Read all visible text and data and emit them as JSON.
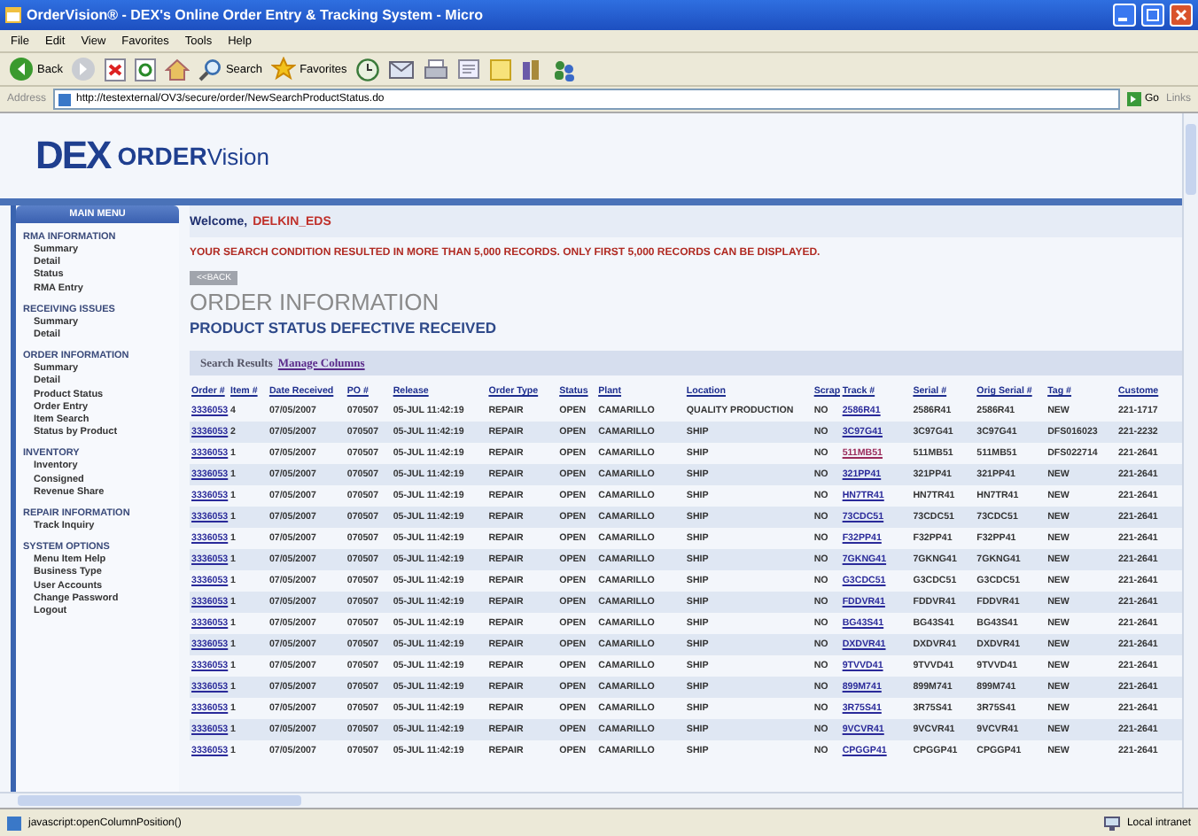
{
  "window": {
    "title": "OrderVision® - DEX's Online Order Entry & Tracking System - Micro"
  },
  "menu": [
    "File",
    "Edit",
    "View",
    "Favorites",
    "Tools",
    "Help"
  ],
  "toolbar": [
    {
      "kind": "back",
      "label": "Back"
    },
    {
      "kind": "forward"
    },
    {
      "kind": "stop"
    },
    {
      "kind": "refresh"
    },
    {
      "kind": "home"
    },
    {
      "kind": "search",
      "label": "Search"
    },
    {
      "kind": "favorites",
      "label": "Favorites"
    },
    {
      "kind": "history"
    },
    {
      "kind": "mail"
    },
    {
      "kind": "print"
    },
    {
      "kind": "edit"
    },
    {
      "kind": "folder"
    },
    {
      "kind": "research"
    },
    {
      "kind": "messenger"
    }
  ],
  "address": {
    "label": "Address",
    "value": "http://testexternal/OV3/secure/order/NewSearchProductStatus.do",
    "go": "Go",
    "links": "Links"
  },
  "logo": {
    "brand": "DEX",
    "product_1": "ORDER",
    "product_2": "Vision"
  },
  "sidebar": {
    "title": "MAIN MENU",
    "sections": [
      {
        "title": "RMA INFORMATION",
        "items": [
          "Summary",
          "Detail",
          "Status",
          "RMA Entry"
        ]
      },
      {
        "title": "RECEIVING ISSUES",
        "items": [
          "Summary",
          "Detail"
        ]
      },
      {
        "title": "ORDER INFORMATION",
        "items": [
          "Summary",
          "Detail",
          "Product Status",
          "Order Entry",
          "Item Search",
          "Status by Product"
        ]
      },
      {
        "title": "INVENTORY",
        "items": [
          "Inventory",
          "Consigned",
          "Revenue Share"
        ]
      },
      {
        "title": "REPAIR INFORMATION",
        "items": [
          "Track Inquiry"
        ]
      },
      {
        "title": "SYSTEM OPTIONS",
        "items": [
          "Menu Item Help",
          "Business Type",
          "User Accounts",
          "Change Password",
          "Logout"
        ]
      }
    ]
  },
  "main": {
    "welcome": "Welcome,",
    "user": "DELKIN_EDS",
    "warning": "YOUR SEARCH CONDITION RESULTED IN MORE THAN 5,000 RECORDS. ONLY FIRST 5,000 RECORDS CAN BE DISPLAYED.",
    "back_button": "<<BACK",
    "heading": "ORDER INFORMATION",
    "subheading": "PRODUCT STATUS DEFECTIVE RECEIVED",
    "results_label": "Search Results",
    "manage_link": "Manage Columns"
  },
  "table": {
    "columns": [
      "Order #",
      "Item #",
      "Date Received",
      "PO #",
      "Release",
      "Order Type",
      "Status",
      "Plant",
      "Location",
      "Scrap",
      "Track #",
      "Serial #",
      "Orig Serial #",
      "Tag #",
      "Custome"
    ],
    "rows": [
      {
        "cells": [
          {
            "text": "3336053",
            "visited": false
          },
          "4",
          "07/05/2007",
          "070507",
          "05-JUL 11:42:19",
          "REPAIR",
          "OPEN",
          "CAMARILLO",
          "QUALITY PRODUCTION",
          "NO",
          {
            "text": "2586R41",
            "visited": false
          },
          "2586R41",
          "2586R41",
          "NEW",
          "221-1717"
        ]
      },
      {
        "cells": [
          {
            "text": "3336053",
            "visited": false
          },
          "2",
          "07/05/2007",
          "070507",
          "05-JUL 11:42:19",
          "REPAIR",
          "OPEN",
          "CAMARILLO",
          "SHIP",
          "NO",
          {
            "text": "3C97G41",
            "visited": false
          },
          "3C97G41",
          "3C97G41",
          "DFS016023",
          "221-2232"
        ]
      },
      {
        "cells": [
          {
            "text": "3336053",
            "visited": false
          },
          "1",
          "07/05/2007",
          "070507",
          "05-JUL 11:42:19",
          "REPAIR",
          "OPEN",
          "CAMARILLO",
          "SHIP",
          "NO",
          {
            "text": "511MB51",
            "visited": true
          },
          "511MB51",
          "511MB51",
          "DFS022714",
          "221-2641"
        ]
      },
      {
        "cells": [
          {
            "text": "3336053",
            "visited": false
          },
          "1",
          "07/05/2007",
          "070507",
          "05-JUL 11:42:19",
          "REPAIR",
          "OPEN",
          "CAMARILLO",
          "SHIP",
          "NO",
          {
            "text": "321PP41",
            "visited": false
          },
          "321PP41",
          "321PP41",
          "NEW",
          "221-2641"
        ]
      },
      {
        "cells": [
          {
            "text": "3336053",
            "visited": false
          },
          "1",
          "07/05/2007",
          "070507",
          "05-JUL 11:42:19",
          "REPAIR",
          "OPEN",
          "CAMARILLO",
          "SHIP",
          "NO",
          {
            "text": "HN7TR41",
            "visited": false
          },
          "HN7TR41",
          "HN7TR41",
          "NEW",
          "221-2641"
        ]
      },
      {
        "cells": [
          {
            "text": "3336053",
            "visited": false
          },
          "1",
          "07/05/2007",
          "070507",
          "05-JUL 11:42:19",
          "REPAIR",
          "OPEN",
          "CAMARILLO",
          "SHIP",
          "NO",
          {
            "text": "73CDC51",
            "visited": false
          },
          "73CDC51",
          "73CDC51",
          "NEW",
          "221-2641"
        ]
      },
      {
        "cells": [
          {
            "text": "3336053",
            "visited": false
          },
          "1",
          "07/05/2007",
          "070507",
          "05-JUL 11:42:19",
          "REPAIR",
          "OPEN",
          "CAMARILLO",
          "SHIP",
          "NO",
          {
            "text": "F32PP41",
            "visited": false
          },
          "F32PP41",
          "F32PP41",
          "NEW",
          "221-2641"
        ]
      },
      {
        "cells": [
          {
            "text": "3336053",
            "visited": false
          },
          "1",
          "07/05/2007",
          "070507",
          "05-JUL 11:42:19",
          "REPAIR",
          "OPEN",
          "CAMARILLO",
          "SHIP",
          "NO",
          {
            "text": "7GKNG41",
            "visited": false
          },
          "7GKNG41",
          "7GKNG41",
          "NEW",
          "221-2641"
        ]
      },
      {
        "cells": [
          {
            "text": "3336053",
            "visited": false
          },
          "1",
          "07/05/2007",
          "070507",
          "05-JUL 11:42:19",
          "REPAIR",
          "OPEN",
          "CAMARILLO",
          "SHIP",
          "NO",
          {
            "text": "G3CDC51",
            "visited": false
          },
          "G3CDC51",
          "G3CDC51",
          "NEW",
          "221-2641"
        ]
      },
      {
        "cells": [
          {
            "text": "3336053",
            "visited": false
          },
          "1",
          "07/05/2007",
          "070507",
          "05-JUL 11:42:19",
          "REPAIR",
          "OPEN",
          "CAMARILLO",
          "SHIP",
          "NO",
          {
            "text": "FDDVR41",
            "visited": false
          },
          "FDDVR41",
          "FDDVR41",
          "NEW",
          "221-2641"
        ]
      },
      {
        "cells": [
          {
            "text": "3336053",
            "visited": false
          },
          "1",
          "07/05/2007",
          "070507",
          "05-JUL 11:42:19",
          "REPAIR",
          "OPEN",
          "CAMARILLO",
          "SHIP",
          "NO",
          {
            "text": "BG43S41",
            "visited": false
          },
          "BG43S41",
          "BG43S41",
          "NEW",
          "221-2641"
        ]
      },
      {
        "cells": [
          {
            "text": "3336053",
            "visited": false
          },
          "1",
          "07/05/2007",
          "070507",
          "05-JUL 11:42:19",
          "REPAIR",
          "OPEN",
          "CAMARILLO",
          "SHIP",
          "NO",
          {
            "text": "DXDVR41",
            "visited": false
          },
          "DXDVR41",
          "DXDVR41",
          "NEW",
          "221-2641"
        ]
      },
      {
        "cells": [
          {
            "text": "3336053",
            "visited": false
          },
          "1",
          "07/05/2007",
          "070507",
          "05-JUL 11:42:19",
          "REPAIR",
          "OPEN",
          "CAMARILLO",
          "SHIP",
          "NO",
          {
            "text": "9TVVD41",
            "visited": false
          },
          "9TVVD41",
          "9TVVD41",
          "NEW",
          "221-2641"
        ]
      },
      {
        "cells": [
          {
            "text": "3336053",
            "visited": false
          },
          "1",
          "07/05/2007",
          "070507",
          "05-JUL 11:42:19",
          "REPAIR",
          "OPEN",
          "CAMARILLO",
          "SHIP",
          "NO",
          {
            "text": "899M741",
            "visited": false
          },
          "899M741",
          "899M741",
          "NEW",
          "221-2641"
        ]
      },
      {
        "cells": [
          {
            "text": "3336053",
            "visited": false
          },
          "1",
          "07/05/2007",
          "070507",
          "05-JUL 11:42:19",
          "REPAIR",
          "OPEN",
          "CAMARILLO",
          "SHIP",
          "NO",
          {
            "text": "3R75S41",
            "visited": false
          },
          "3R75S41",
          "3R75S41",
          "NEW",
          "221-2641"
        ]
      },
      {
        "cells": [
          {
            "text": "3336053",
            "visited": false
          },
          "1",
          "07/05/2007",
          "070507",
          "05-JUL 11:42:19",
          "REPAIR",
          "OPEN",
          "CAMARILLO",
          "SHIP",
          "NO",
          {
            "text": "9VCVR41",
            "visited": false
          },
          "9VCVR41",
          "9VCVR41",
          "NEW",
          "221-2641"
        ]
      },
      {
        "cells": [
          {
            "text": "3336053",
            "visited": false
          },
          "1",
          "07/05/2007",
          "070507",
          "05-JUL 11:42:19",
          "REPAIR",
          "OPEN",
          "CAMARILLO",
          "SHIP",
          "NO",
          {
            "text": "CPGGP41",
            "visited": false
          },
          "CPGGP41",
          "CPGGP41",
          "NEW",
          "221-2641"
        ]
      }
    ]
  },
  "status_bar": {
    "text": "javascript:openColumnPosition()",
    "zone": "Local intranet"
  }
}
